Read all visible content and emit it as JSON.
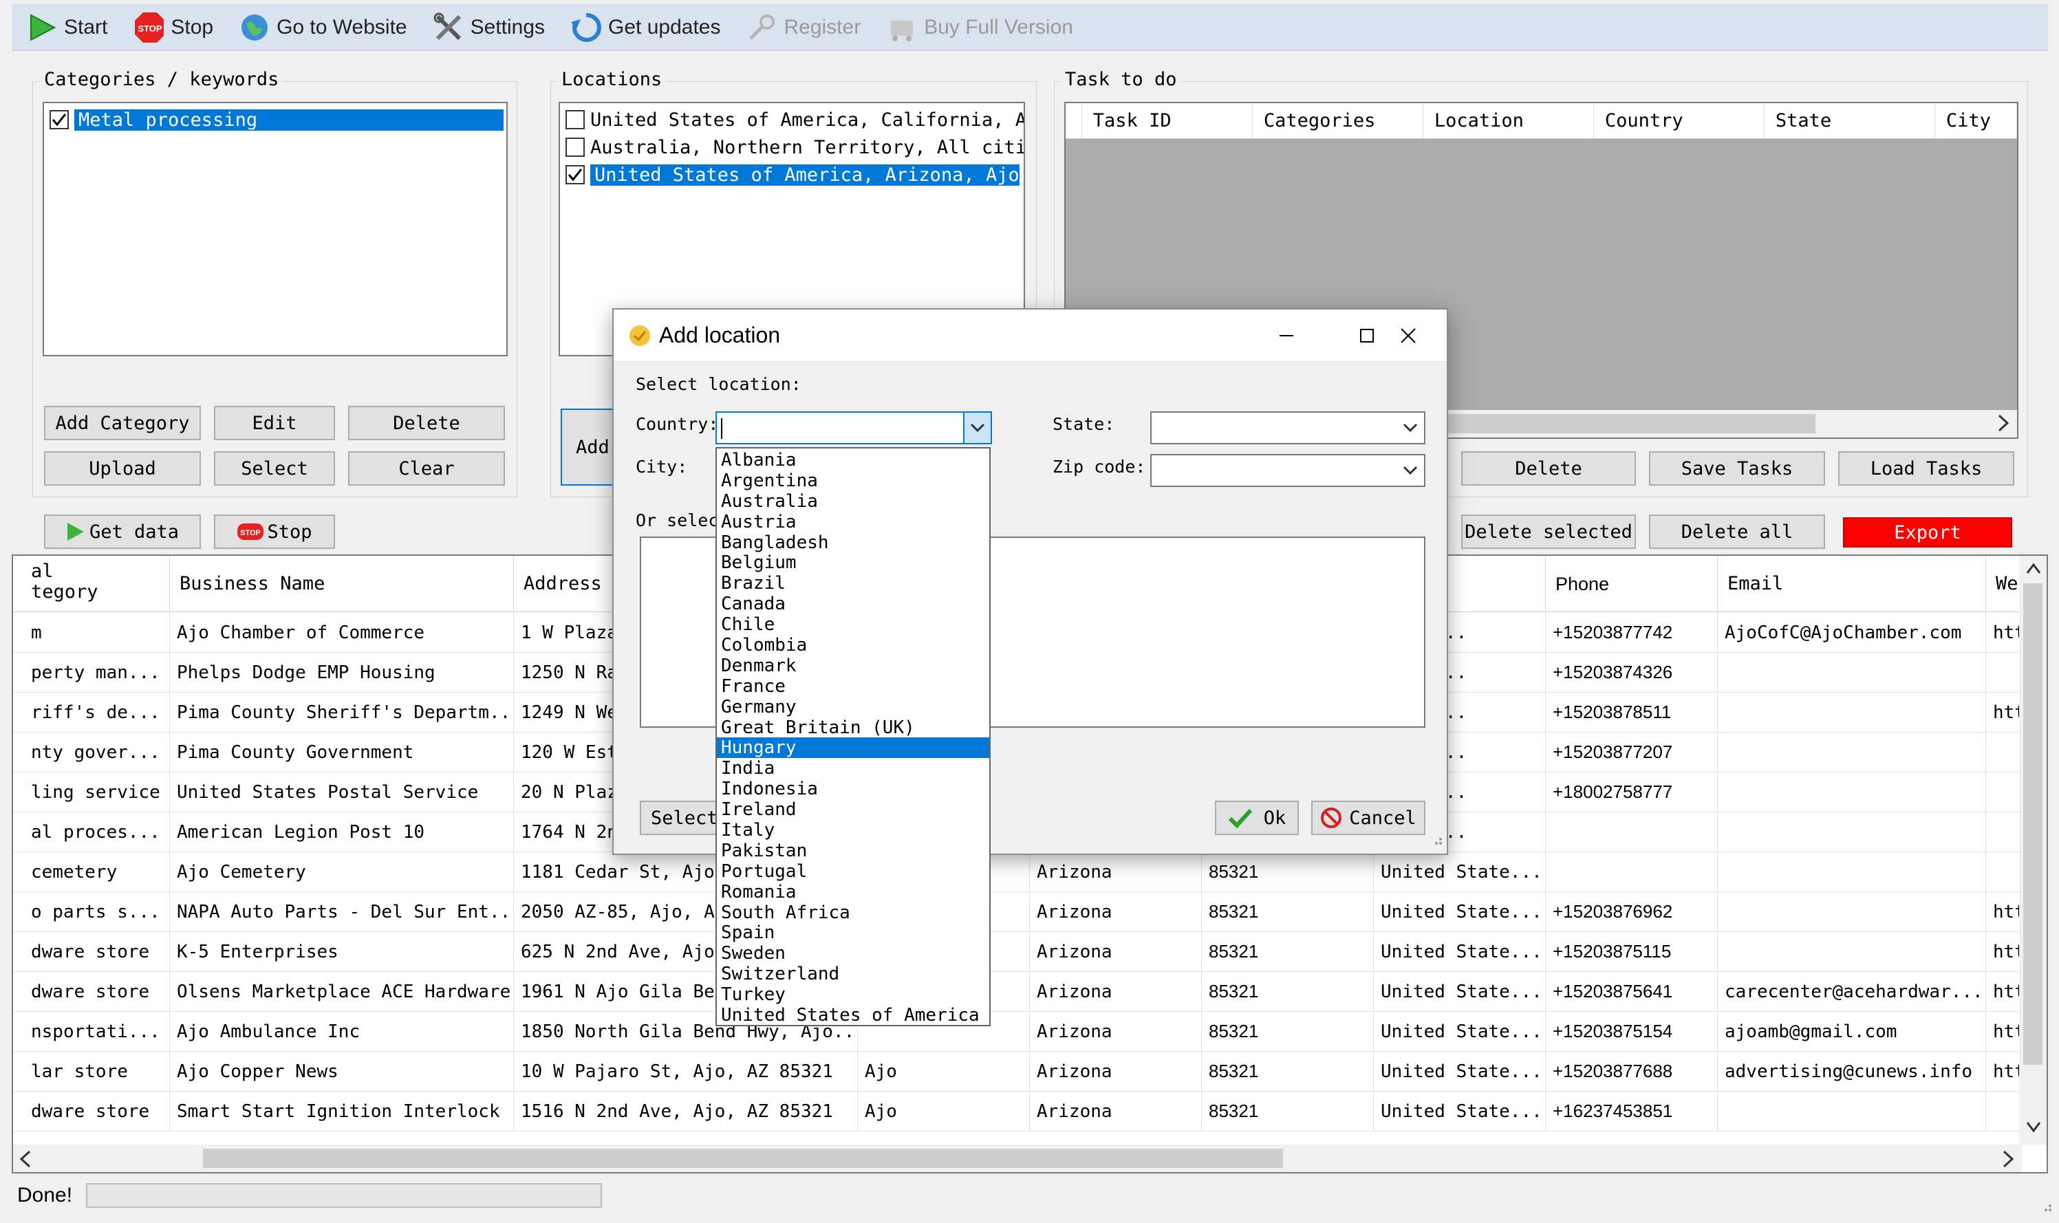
{
  "toolbar": {
    "start": "Start",
    "stop": "Stop",
    "website": "Go to Website",
    "settings": "Settings",
    "updates": "Get updates",
    "register": "Register",
    "buy": "Buy Full Version"
  },
  "categories": {
    "title": "Categories / keywords",
    "items": [
      {
        "label": "Metal processing",
        "checked": true
      }
    ],
    "buttons": {
      "add": "Add Category",
      "edit": "Edit",
      "delete": "Delete",
      "upload": "Upload",
      "select": "Select",
      "clear": "Clear"
    }
  },
  "locations": {
    "title": "Locations",
    "items": [
      {
        "label": "United States of America, California, Ata:",
        "checked": false
      },
      {
        "label": "Australia, Northern Territory, All cities,",
        "checked": false
      },
      {
        "label": "United States of America, Arizona, Ajo, A",
        "checked": true
      }
    ],
    "add_button": "Add"
  },
  "tasks": {
    "title": "Task to do",
    "columns": [
      "Task ID",
      "Categories",
      "Location",
      "Country",
      "State",
      "City"
    ],
    "buttons": {
      "delete": "Delete",
      "save": "Save Tasks",
      "load": "Load Tasks"
    }
  },
  "data_controls": {
    "get_data": "Get data",
    "stop": "Stop",
    "delete_selected": "Delete selected",
    "delete_all": "Delete all",
    "export": "Export"
  },
  "results": {
    "columns": [
      "al\ntegory",
      "Business Name",
      "Address",
      "",
      "",
      "",
      "y",
      "Phone",
      "Email",
      "Web"
    ],
    "rows": [
      [
        "m",
        "Ajo Chamber of Commerce",
        "1 W Plaza",
        "",
        "",
        "",
        "State...",
        "+15203877742",
        "AjoCofC@AjoChamber.com",
        "http"
      ],
      [
        "perty man...",
        "Phelps Dodge EMP Housing",
        "1250 N Ra",
        "",
        "",
        "",
        "State...",
        "+15203874326",
        "",
        ""
      ],
      [
        "riff's de...",
        "Pima County Sheriff's Departm...",
        "1249 N We",
        "",
        "",
        "",
        "State...",
        "+15203878511",
        "",
        "http"
      ],
      [
        "nty gover...",
        "Pima County Government",
        "120 W Est",
        "",
        "",
        "",
        "State...",
        "+15203877207",
        "",
        ""
      ],
      [
        "ling service",
        "United States Postal Service",
        "20 N Plaz",
        "",
        "",
        "",
        "State...",
        "+18002758777",
        "",
        ""
      ],
      [
        "al proces...",
        "American Legion Post 10",
        "1764 N 2n",
        "",
        "",
        "",
        "State...",
        "",
        "",
        ""
      ],
      [
        " cemetery",
        "Ajo Cemetery",
        "1181 Cedar St, Ajo,",
        "",
        "Arizona",
        "85321",
        "United State...",
        "",
        "",
        ""
      ],
      [
        "o parts s...",
        "NAPA Auto Parts - Del Sur Ent...",
        "2050 AZ-85, Ajo, AZ",
        "",
        "Arizona",
        "85321",
        "United State...",
        "+15203876962",
        "",
        "http"
      ],
      [
        "dware store",
        "K-5 Enterprises",
        "625 N 2nd Ave, Ajo,",
        "",
        "Arizona",
        "85321",
        "United State...",
        "+15203875115",
        "",
        "http"
      ],
      [
        "dware store",
        "Olsens Marketplace ACE Hardware",
        "1961 N Ajo Gila Ben",
        "",
        "Arizona",
        "85321",
        "United State...",
        "+15203875641",
        "carecenter@acehardwar...",
        "http"
      ],
      [
        "nsportati...",
        "Ajo Ambulance Inc",
        "1850 North Gila Bend Hwy, Ajo...",
        "",
        "Arizona",
        "85321",
        "United State...",
        "+15203875154",
        "ajoamb@gmail.com",
        "http"
      ],
      [
        "lar store",
        "Ajo Copper News",
        "10 W Pajaro St, Ajo, AZ 85321",
        "Ajo",
        "Arizona",
        "85321",
        "United State...",
        "+15203877688",
        "advertising@cunews.info",
        "http"
      ],
      [
        "dware store",
        "Smart Start Ignition Interlock",
        "1516 N 2nd Ave, Ajo, AZ 85321",
        "Ajo",
        "Arizona",
        "85321",
        "United State...",
        "+16237453851",
        "",
        ""
      ]
    ]
  },
  "status": {
    "text": "Done!"
  },
  "dialog": {
    "title": "Add location",
    "select_location": "Select location:",
    "country_label": "Country:",
    "country_value": "",
    "state_label": "State:",
    "city_label": "City:",
    "zip_label": "Zip code:",
    "or_select": "Or selec",
    "select_button": "Select",
    "ok": "Ok",
    "cancel": "Cancel",
    "countries": [
      "Albania",
      "Argentina",
      "Australia",
      "Austria",
      "Bangladesh",
      "Belgium",
      "Brazil",
      "Canada",
      "Chile",
      "Colombia",
      "Denmark",
      "France",
      "Germany",
      "Great Britain (UK)",
      "Hungary",
      "India",
      "Indonesia",
      "Ireland",
      "Italy",
      "Pakistan",
      "Portugal",
      "Romania",
      "South Africa",
      "Spain",
      "Sweden",
      "Switzerland",
      "Turkey",
      "United States of America"
    ],
    "highlighted_country": "Hungary"
  },
  "colors": {
    "selection": "#0078d7",
    "export": "#ff0000",
    "toolbar": "#d9e3ef",
    "task_grid": "#ababab"
  }
}
